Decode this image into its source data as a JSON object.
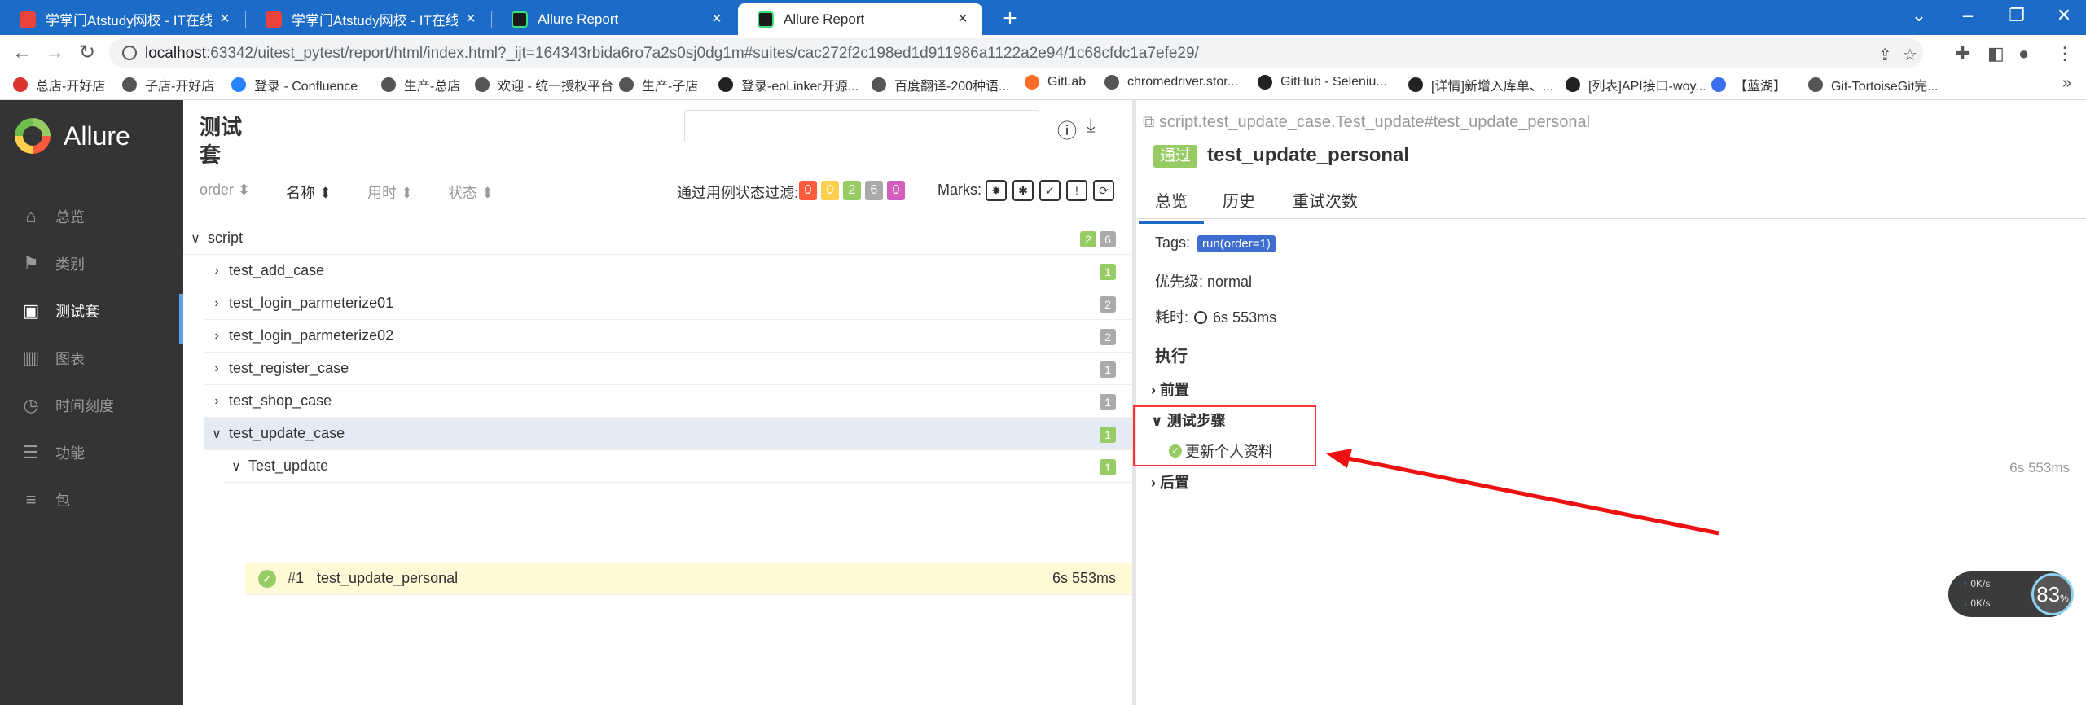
{
  "browser": {
    "tabs": [
      {
        "title": "学掌门Atstudy网校 - IT在线学习",
        "active": false
      },
      {
        "title": "学掌门Atstudy网校 - IT在线学习",
        "active": false
      },
      {
        "title": "Allure Report",
        "active": false
      },
      {
        "title": "Allure Report",
        "active": true
      }
    ],
    "new_tab": "+",
    "url_host": "localhost",
    "url_rest": ":63342/uitest_pytest/report/html/index.html?_ijt=164343rbida6ro7a2s0sj0dg1m#suites/cac272f2c198ed1d911986a1122a2e94/1c68cfdc1a7efe29/",
    "bookmarks": [
      {
        "label": "总店-开好店",
        "color": "#d9332e"
      },
      {
        "label": "子店-开好店",
        "color": "#555555"
      },
      {
        "label": "登录 - Confluence",
        "color": "#2684ff"
      },
      {
        "label": "生产-总店",
        "color": "#555555"
      },
      {
        "label": "欢迎 - 统一授权平台",
        "color": "#555555"
      },
      {
        "label": "生产-子店",
        "color": "#555555"
      },
      {
        "label": "登录-eoLinker开源...",
        "color": "#222222"
      },
      {
        "label": "百度翻译-200种语...",
        "color": "#555555"
      },
      {
        "label": "GitLab",
        "color": "#fc6d26"
      },
      {
        "label": "chromedriver.stor...",
        "color": "#555555"
      },
      {
        "label": "GitHub - Seleniu...",
        "color": "#222222"
      },
      {
        "label": "[详情]新增入库单、...",
        "color": "#222222"
      },
      {
        "label": "[列表]API接口-woy...",
        "color": "#222222"
      },
      {
        "label": "【蓝湖】",
        "color": "#3a6df0"
      },
      {
        "label": "Git-TortoiseGit完...",
        "color": "#555555"
      }
    ]
  },
  "allure": {
    "brand": "Allure",
    "nav": [
      {
        "label": "总览",
        "icon": "home-icon",
        "glyph": "⌂",
        "active": false
      },
      {
        "label": "类别",
        "icon": "flag-icon",
        "glyph": "⚑",
        "active": false
      },
      {
        "label": "测试套",
        "icon": "briefcase-icon",
        "glyph": "▣",
        "active": true
      },
      {
        "label": "图表",
        "icon": "bar-chart-icon",
        "glyph": "▥",
        "active": false
      },
      {
        "label": "时间刻度",
        "icon": "clock-icon",
        "glyph": "◷",
        "active": false
      },
      {
        "label": "功能",
        "icon": "list-icon",
        "glyph": "☰",
        "active": false
      },
      {
        "label": "包",
        "icon": "package-icon",
        "glyph": "≡",
        "active": false
      }
    ],
    "suites": {
      "title": "测试套",
      "sort": [
        {
          "label": "order",
          "active": false
        },
        {
          "label": "名称",
          "active": true
        },
        {
          "label": "用时",
          "active": false
        },
        {
          "label": "状态",
          "active": false
        }
      ],
      "filter_label": "通过用例状态过滤:",
      "status_filters": [
        {
          "value": "0",
          "color": "#fd5a3e"
        },
        {
          "value": "0",
          "color": "#ffd050"
        },
        {
          "value": "2",
          "color": "#97cc64"
        },
        {
          "value": "6",
          "color": "#aaaaaa"
        },
        {
          "value": "0",
          "color": "#d35ebe"
        }
      ],
      "marks_label": "Marks:",
      "marks": [
        "✸",
        "✱",
        "✓",
        "!",
        "⟳"
      ],
      "tree": [
        {
          "label": "script",
          "level": 0,
          "chev": "∨",
          "counts": [
            {
              "v": "2",
              "c": "#97cc64"
            },
            {
              "v": "6",
              "c": "#aaaaaa"
            }
          ],
          "selected": false
        },
        {
          "label": "test_add_case",
          "level": 1,
          "chev": "›",
          "counts": [
            {
              "v": "1",
              "c": "#97cc64"
            }
          ],
          "selected": false
        },
        {
          "label": "test_login_parmeterize01",
          "level": 1,
          "chev": "›",
          "counts": [
            {
              "v": "2",
              "c": "#aaaaaa"
            }
          ],
          "selected": false
        },
        {
          "label": "test_login_parmeterize02",
          "level": 1,
          "chev": "›",
          "counts": [
            {
              "v": "2",
              "c": "#aaaaaa"
            }
          ],
          "selected": false
        },
        {
          "label": "test_register_case",
          "level": 1,
          "chev": "›",
          "counts": [
            {
              "v": "1",
              "c": "#aaaaaa"
            }
          ],
          "selected": false
        },
        {
          "label": "test_shop_case",
          "level": 1,
          "chev": "›",
          "counts": [
            {
              "v": "1",
              "c": "#aaaaaa"
            }
          ],
          "selected": false
        },
        {
          "label": "test_update_case",
          "level": 1,
          "chev": "∨",
          "counts": [
            {
              "v": "1",
              "c": "#97cc64"
            }
          ],
          "selected": true
        },
        {
          "label": "Test_update",
          "level": 2,
          "chev": "∨",
          "counts": [
            {
              "v": "1",
              "c": "#97cc64"
            }
          ],
          "selected": false
        }
      ],
      "leaf": {
        "num": "#1",
        "name": "test_update_personal",
        "duration": "6s 553ms"
      }
    },
    "detail": {
      "path": "script.test_update_case.Test_update#test_update_personal",
      "status": "通过",
      "title": "test_update_personal",
      "tabs": [
        "总览",
        "历史",
        "重试次数"
      ],
      "tags_label": "Tags:",
      "tag": "run(order=1)",
      "priority": "优先级: normal",
      "duration_label": "耗时:",
      "duration": "6s 553ms",
      "execution_heading": "执行",
      "setup_label": "前置",
      "steps_label": "测试步骤",
      "step": "更新个人资料",
      "step_duration": "6s 553ms",
      "teardown_label": "后置"
    }
  },
  "widget": {
    "up": "0K/s",
    "down": "0K/s",
    "percent": "83",
    "percent_unit": "%"
  }
}
